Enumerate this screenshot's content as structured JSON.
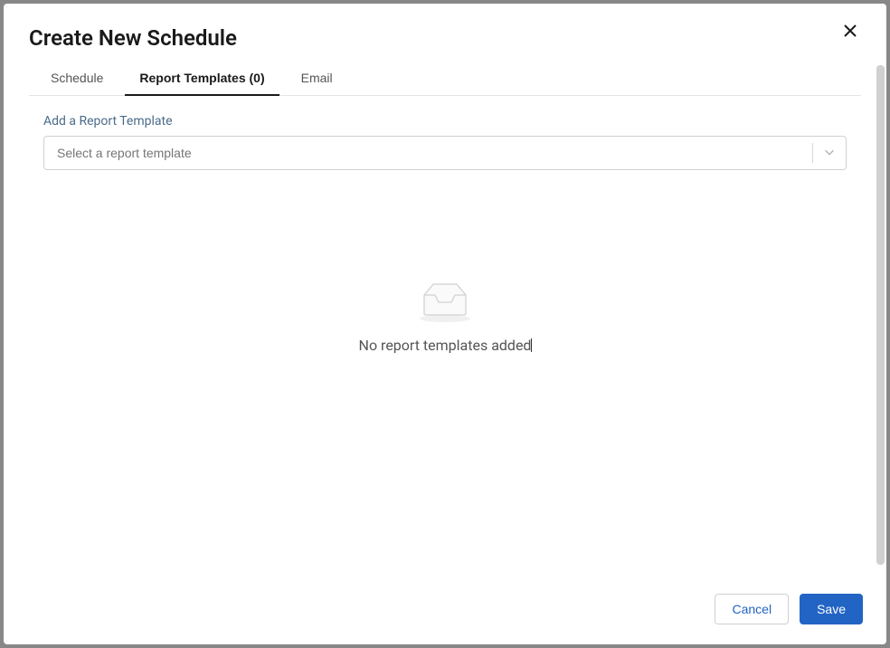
{
  "modal": {
    "title": "Create New Schedule",
    "tabs": [
      {
        "label": "Schedule",
        "active": false
      },
      {
        "label": "Report Templates (0)",
        "active": true
      },
      {
        "label": "Email",
        "active": false
      }
    ]
  },
  "body": {
    "field_label": "Add a Report Template",
    "select_placeholder": "Select a report template",
    "empty_message": "No report templates added"
  },
  "footer": {
    "cancel_label": "Cancel",
    "save_label": "Save"
  }
}
